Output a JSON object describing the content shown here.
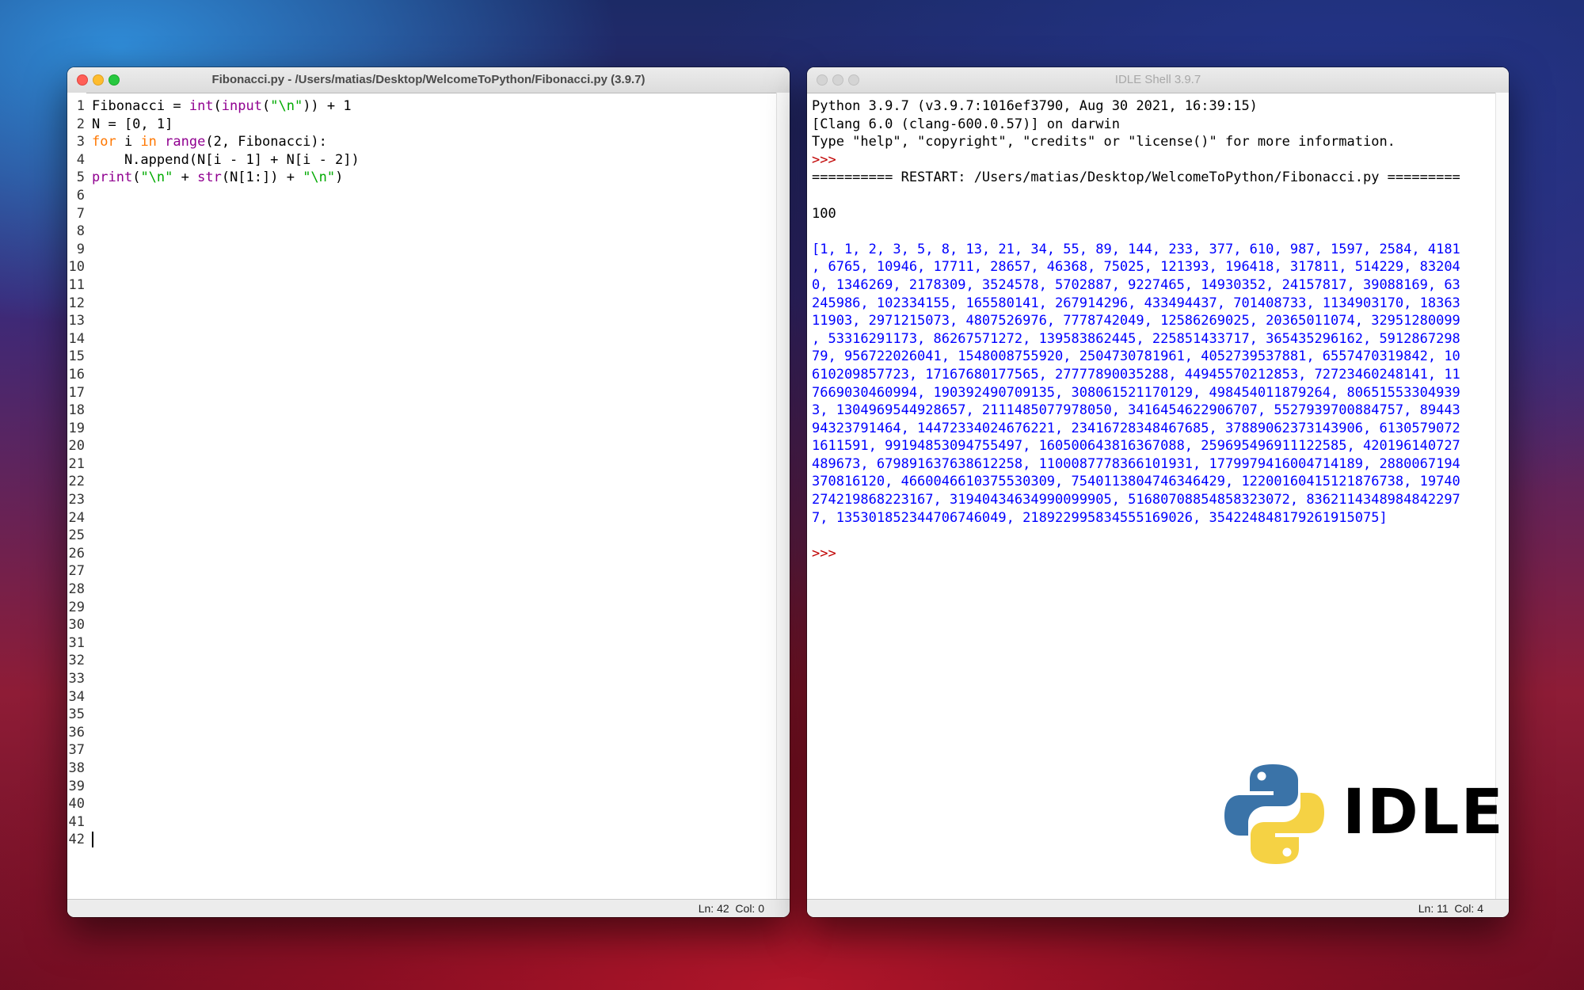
{
  "editor": {
    "title": "Fibonacci.py - /Users/matias/Desktop/WelcomeToPython/Fibonacci.py (3.9.7)",
    "code_lines": [
      [
        {
          "t": "Fibonacci = "
        },
        {
          "t": "int",
          "c": "bi"
        },
        {
          "t": "("
        },
        {
          "t": "input",
          "c": "bi"
        },
        {
          "t": "("
        },
        {
          "t": "\"\\n\"",
          "c": "str"
        },
        {
          "t": ")) + 1"
        }
      ],
      [
        {
          "t": "N = [0, 1]"
        }
      ],
      [
        {
          "t": "for",
          "c": "kw"
        },
        {
          "t": " i "
        },
        {
          "t": "in",
          "c": "kw"
        },
        {
          "t": " "
        },
        {
          "t": "range",
          "c": "bi"
        },
        {
          "t": "(2, Fibonacci):"
        }
      ],
      [
        {
          "t": "    N.append(N[i - 1] + N[i - 2])"
        }
      ],
      [
        {
          "t": "print",
          "c": "bi"
        },
        {
          "t": "("
        },
        {
          "t": "\"\\n\"",
          "c": "str"
        },
        {
          "t": " + "
        },
        {
          "t": "str",
          "c": "bi"
        },
        {
          "t": "(N[1:]) + "
        },
        {
          "t": "\"\\n\"",
          "c": "str"
        },
        {
          "t": ")"
        }
      ]
    ],
    "line_count": 42,
    "status": "Ln: 42  Col: 0"
  },
  "shell": {
    "title": "IDLE Shell 3.9.7",
    "lines": [
      {
        "t": "Python 3.9.7 (v3.9.7:1016ef3790, Aug 30 2021, 16:39:15)"
      },
      {
        "t": "[Clang 6.0 (clang-600.0.57)] on darwin"
      },
      {
        "t": "Type \"help\", \"copyright\", \"credits\" or \"license()\" for more information."
      },
      {
        "t": ">>> ",
        "c": "prompt"
      },
      {
        "t": "========== RESTART: /Users/matias/Desktop/WelcomeToPython/Fibonacci.py ========="
      },
      {
        "t": ""
      },
      {
        "t": "100"
      },
      {
        "t": ""
      },
      {
        "t": "[1, 1, 2, 3, 5, 8, 13, 21, 34, 55, 89, 144, 233, 377, 610, 987, 1597, 2584, 4181",
        "c": "stdout"
      },
      {
        "t": ", 6765, 10946, 17711, 28657, 46368, 75025, 121393, 196418, 317811, 514229, 83204",
        "c": "stdout"
      },
      {
        "t": "0, 1346269, 2178309, 3524578, 5702887, 9227465, 14930352, 24157817, 39088169, 63",
        "c": "stdout"
      },
      {
        "t": "245986, 102334155, 165580141, 267914296, 433494437, 701408733, 1134903170, 18363",
        "c": "stdout"
      },
      {
        "t": "11903, 2971215073, 4807526976, 7778742049, 12586269025, 20365011074, 32951280099",
        "c": "stdout"
      },
      {
        "t": ", 53316291173, 86267571272, 139583862445, 225851433717, 365435296162, 5912867298",
        "c": "stdout"
      },
      {
        "t": "79, 956722026041, 1548008755920, 2504730781961, 4052739537881, 6557470319842, 10",
        "c": "stdout"
      },
      {
        "t": "610209857723, 17167680177565, 27777890035288, 44945570212853, 72723460248141, 11",
        "c": "stdout"
      },
      {
        "t": "7669030460994, 190392490709135, 308061521170129, 498454011879264, 80651553304939",
        "c": "stdout"
      },
      {
        "t": "3, 1304969544928657, 2111485077978050, 3416454622906707, 5527939700884757, 89443",
        "c": "stdout"
      },
      {
        "t": "94323791464, 14472334024676221, 23416728348467685, 37889062373143906, 6130579072",
        "c": "stdout"
      },
      {
        "t": "1611591, 99194853094755497, 160500643816367088, 259695496911122585, 420196140727",
        "c": "stdout"
      },
      {
        "t": "489673, 679891637638612258, 1100087778366101931, 1779979416004714189, 2880067194",
        "c": "stdout"
      },
      {
        "t": "370816120, 4660046610375530309, 7540113804746346429, 12200160415121876738, 19740",
        "c": "stdout"
      },
      {
        "t": "274219868223167, 31940434634990099905, 51680708854858323072, 8362114348984842297",
        "c": "stdout"
      },
      {
        "t": "7, 135301852344706746049, 218922995834555169026, 354224848179261915075]",
        "c": "stdout"
      },
      {
        "t": ""
      },
      {
        "t": ">>> ",
        "c": "prompt"
      }
    ],
    "status": "Ln: 11  Col: 4"
  },
  "logo": {
    "text": "IDLE",
    "icon": "python-logo-icon",
    "colors": {
      "blue": "#3a73a8",
      "yellow": "#f5d244"
    }
  }
}
